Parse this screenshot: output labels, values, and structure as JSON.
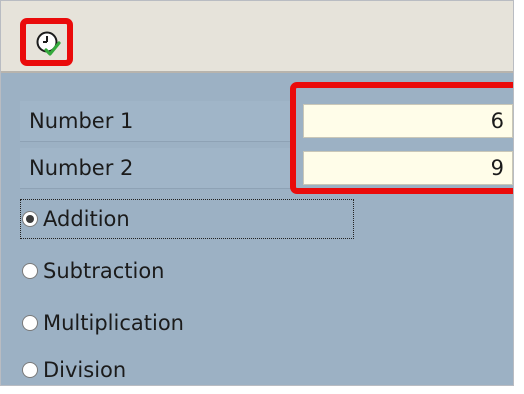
{
  "toolbar": {
    "execute_icon": "execute-clock-check-icon"
  },
  "form": {
    "number1": {
      "label": "Number 1",
      "value": "6"
    },
    "number2": {
      "label": "Number 2",
      "value": "9"
    },
    "operations": [
      {
        "label": "Addition",
        "selected": true
      },
      {
        "label": "Subtraction",
        "selected": false
      },
      {
        "label": "Multiplication",
        "selected": false
      },
      {
        "label": "Division",
        "selected": false
      }
    ]
  },
  "colors": {
    "highlight": "#ea0b0b",
    "background": "#9cb1c4",
    "input_bg": "#fffde9"
  }
}
